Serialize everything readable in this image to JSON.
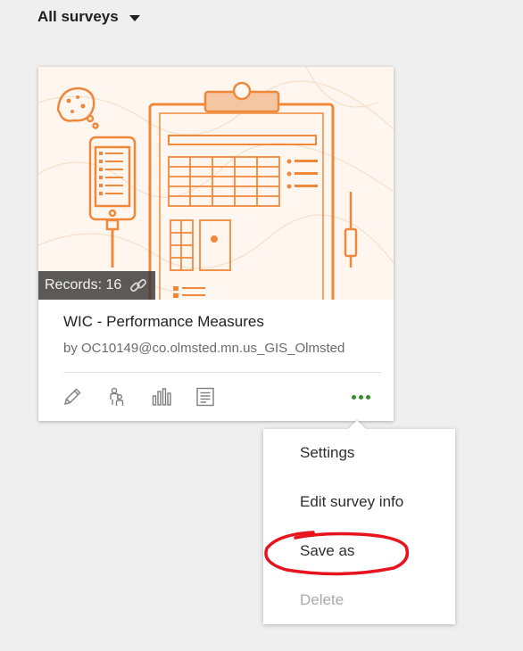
{
  "filter": {
    "label": "All surveys",
    "icon": "caret-down-icon"
  },
  "survey_card": {
    "records_label": "Records: 16",
    "records_count": 16,
    "title": "WIC - Performance Measures",
    "owner": "by OC10149@co.olmsted.mn.us_GIS_Olmsted",
    "actions": [
      {
        "name": "edit",
        "icon": "pencil-icon"
      },
      {
        "name": "collaborate",
        "icon": "people-icon"
      },
      {
        "name": "analyze",
        "icon": "bar-chart-icon"
      },
      {
        "name": "data",
        "icon": "table-icon"
      },
      {
        "name": "more",
        "icon": "ellipsis-icon"
      }
    ]
  },
  "menu": {
    "items": [
      {
        "label": "Settings",
        "enabled": true
      },
      {
        "label": "Edit survey info",
        "enabled": true
      },
      {
        "label": "Save as",
        "enabled": true
      },
      {
        "label": "Delete",
        "enabled": false
      }
    ]
  },
  "colors": {
    "accent": "#3a8a2e",
    "illustration": "#f0883c",
    "annotation": "#e8141d"
  }
}
